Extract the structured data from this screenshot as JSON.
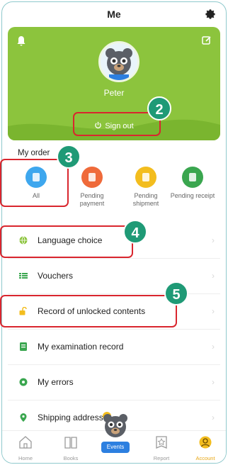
{
  "header": {
    "title": "Me",
    "settings_icon": "gear-icon"
  },
  "profile": {
    "name": "Peter",
    "sign_out_label": "Sign out",
    "bell_icon": "bell-icon",
    "edit_icon": "edit-icon",
    "background_color": "#8cc43d"
  },
  "order": {
    "title": "My order",
    "items": [
      {
        "label": "All",
        "color": "#3ea7ee",
        "icon": "list-icon"
      },
      {
        "label": "Pending payment",
        "color": "#ef6a3a",
        "icon": "wallet-icon"
      },
      {
        "label": "Pending shipment",
        "color": "#f3bd1e",
        "icon": "box-icon"
      },
      {
        "label": "Pending receipt",
        "color": "#3aa64f",
        "icon": "truck-icon"
      }
    ]
  },
  "menu": [
    {
      "label": "Language choice",
      "icon": "globe-icon",
      "color": "#8cc43d"
    },
    {
      "label": "Vouchers",
      "icon": "voucher-icon",
      "color": "#3aa64f"
    },
    {
      "label": "Record of unlocked contents",
      "icon": "unlock-icon",
      "color": "#f3bd1e"
    },
    {
      "label": "My examination record",
      "icon": "exam-icon",
      "color": "#3aa64f"
    },
    {
      "label": "My errors",
      "icon": "error-icon",
      "color": "#3aa64f"
    },
    {
      "label": "Shipping address",
      "icon": "location-icon",
      "color": "#3aa64f"
    }
  ],
  "callouts": {
    "sign_out": "2",
    "order_all": "3",
    "language": "4",
    "unlocked": "5"
  },
  "tabs": [
    {
      "label": "Home",
      "icon": "home-icon"
    },
    {
      "label": "Books",
      "icon": "book-icon"
    },
    {
      "label": "Events",
      "icon": "events-icon"
    },
    {
      "label": "Report",
      "icon": "report-icon"
    },
    {
      "label": "Account",
      "icon": "account-icon",
      "active": true
    }
  ],
  "accent_color": "#e8a817",
  "callout_color": "#d9262e",
  "badge_color": "#1f9a76"
}
